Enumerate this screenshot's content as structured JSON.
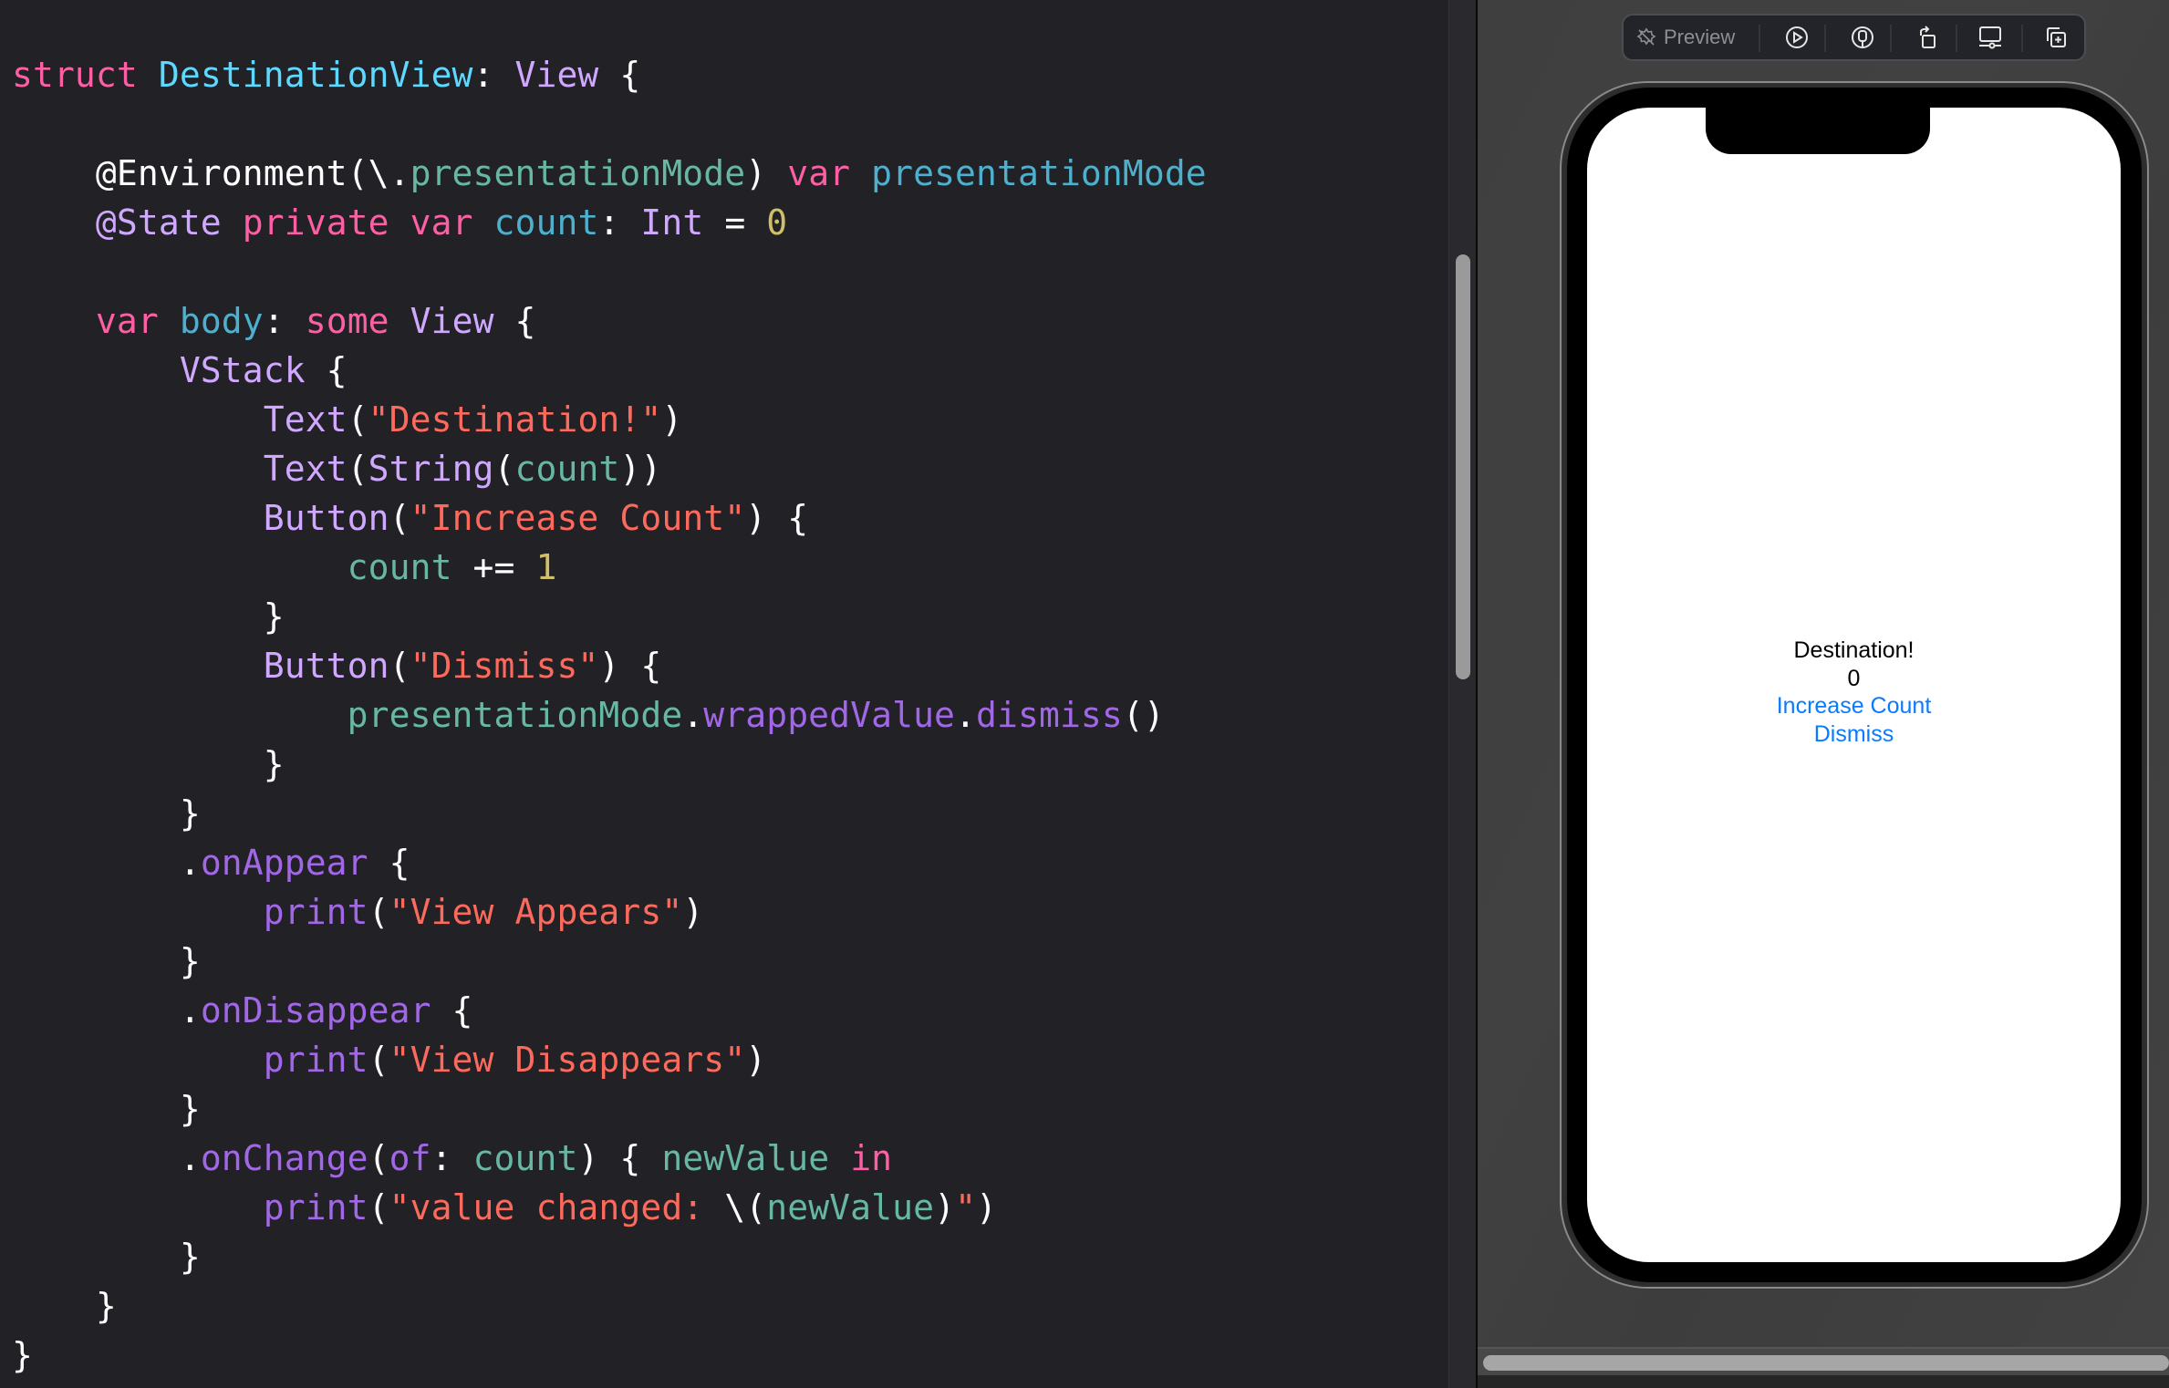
{
  "editor": {
    "language": "swift",
    "lines": [
      [
        [
          "kw",
          "struct"
        ],
        [
          "plain",
          " "
        ],
        [
          "decl",
          "DestinationView"
        ],
        [
          "plain",
          ": "
        ],
        [
          "type",
          "View"
        ],
        [
          "plain",
          " {"
        ]
      ],
      [],
      [
        [
          "plain",
          "    @Environment(\\."
        ],
        [
          "ref",
          "presentationMode"
        ],
        [
          "plain",
          ") "
        ],
        [
          "kw",
          "var"
        ],
        [
          "plain",
          " "
        ],
        [
          "decl2",
          "presentationMode"
        ]
      ],
      [
        [
          "plain",
          "    "
        ],
        [
          "attr",
          "@State"
        ],
        [
          "plain",
          " "
        ],
        [
          "kw",
          "private"
        ],
        [
          "plain",
          " "
        ],
        [
          "kw",
          "var"
        ],
        [
          "plain",
          " "
        ],
        [
          "decl2",
          "count"
        ],
        [
          "plain",
          ": "
        ],
        [
          "type",
          "Int"
        ],
        [
          "plain",
          " = "
        ],
        [
          "num",
          "0"
        ]
      ],
      [],
      [
        [
          "plain",
          "    "
        ],
        [
          "kw",
          "var"
        ],
        [
          "plain",
          " "
        ],
        [
          "decl2",
          "body"
        ],
        [
          "plain",
          ": "
        ],
        [
          "kw",
          "some"
        ],
        [
          "plain",
          " "
        ],
        [
          "type",
          "View"
        ],
        [
          "plain",
          " {"
        ]
      ],
      [
        [
          "plain",
          "        "
        ],
        [
          "type",
          "VStack"
        ],
        [
          "plain",
          " {"
        ]
      ],
      [
        [
          "plain",
          "            "
        ],
        [
          "type",
          "Text"
        ],
        [
          "plain",
          "("
        ],
        [
          "str",
          "\"Destination!\""
        ],
        [
          "plain",
          ")"
        ]
      ],
      [
        [
          "plain",
          "            "
        ],
        [
          "type",
          "Text"
        ],
        [
          "plain",
          "("
        ],
        [
          "type",
          "String"
        ],
        [
          "plain",
          "("
        ],
        [
          "ref",
          "count"
        ],
        [
          "plain",
          "))"
        ]
      ],
      [
        [
          "plain",
          "            "
        ],
        [
          "type",
          "Button"
        ],
        [
          "plain",
          "("
        ],
        [
          "str",
          "\"Increase Count\""
        ],
        [
          "plain",
          ") {"
        ]
      ],
      [
        [
          "plain",
          "                "
        ],
        [
          "ref",
          "count"
        ],
        [
          "plain",
          " += "
        ],
        [
          "num",
          "1"
        ]
      ],
      [
        [
          "plain",
          "            }"
        ]
      ],
      [
        [
          "plain",
          "            "
        ],
        [
          "type",
          "Button"
        ],
        [
          "plain",
          "("
        ],
        [
          "str",
          "\"Dismiss\""
        ],
        [
          "plain",
          ") {"
        ]
      ],
      [
        [
          "plain",
          "                "
        ],
        [
          "ref",
          "presentationMode"
        ],
        [
          "plain",
          "."
        ],
        [
          "fn",
          "wrappedValue"
        ],
        [
          "plain",
          "."
        ],
        [
          "fn",
          "dismiss"
        ],
        [
          "plain",
          "()"
        ]
      ],
      [
        [
          "plain",
          "            }"
        ]
      ],
      [
        [
          "plain",
          "        }"
        ]
      ],
      [
        [
          "plain",
          "        ."
        ],
        [
          "fn",
          "onAppear"
        ],
        [
          "plain",
          " {"
        ]
      ],
      [
        [
          "plain",
          "            "
        ],
        [
          "fn",
          "print"
        ],
        [
          "plain",
          "("
        ],
        [
          "str",
          "\"View Appears\""
        ],
        [
          "plain",
          ")"
        ]
      ],
      [
        [
          "plain",
          "        }"
        ]
      ],
      [
        [
          "plain",
          "        ."
        ],
        [
          "fn",
          "onDisappear"
        ],
        [
          "plain",
          " {"
        ]
      ],
      [
        [
          "plain",
          "            "
        ],
        [
          "fn",
          "print"
        ],
        [
          "plain",
          "("
        ],
        [
          "str",
          "\"View Disappears\""
        ],
        [
          "plain",
          ")"
        ]
      ],
      [
        [
          "plain",
          "        }"
        ]
      ],
      [
        [
          "plain",
          "        ."
        ],
        [
          "fn",
          "onChange"
        ],
        [
          "plain",
          "("
        ],
        [
          "fn",
          "of"
        ],
        [
          "plain",
          ": "
        ],
        [
          "ref",
          "count"
        ],
        [
          "plain",
          ") { "
        ],
        [
          "ref",
          "newValue"
        ],
        [
          "plain",
          " "
        ],
        [
          "kw",
          "in"
        ]
      ],
      [
        [
          "plain",
          "            "
        ],
        [
          "fn",
          "print"
        ],
        [
          "plain",
          "("
        ],
        [
          "str",
          "\"value changed: "
        ],
        [
          "plain",
          "\\("
        ],
        [
          "ref",
          "newValue"
        ],
        [
          "plain",
          ")"
        ],
        [
          "str",
          "\""
        ],
        [
          "plain",
          ")"
        ]
      ],
      [
        [
          "plain",
          "        }"
        ]
      ],
      [
        [
          "plain",
          "    }"
        ]
      ],
      [
        [
          "plain",
          "}"
        ]
      ]
    ],
    "colors": {
      "background": "#212126",
      "keyword": "#fc5fa3",
      "type_declaration": "#5dd8ff",
      "other_declaration": "#4eb0cc",
      "type": "#d0a8ff",
      "reference": "#67b7a4",
      "function": "#a167e6",
      "string": "#fc6a5d",
      "number": "#d0bf69",
      "plain": "#ffffff"
    }
  },
  "preview_toolbar": {
    "label": "Preview",
    "items": [
      {
        "icon": "live-preview-off-icon",
        "label": "Preview"
      },
      {
        "icon": "play-icon"
      },
      {
        "icon": "device-icon"
      },
      {
        "icon": "rotate-icon"
      },
      {
        "icon": "device-settings-icon"
      },
      {
        "icon": "duplicate-icon"
      }
    ]
  },
  "simulator": {
    "device": "iPhone",
    "screen": {
      "title_text": "Destination!",
      "count_text": "0",
      "increase_button_label": "Increase Count",
      "dismiss_button_label": "Dismiss"
    },
    "colors": {
      "text": "#000000",
      "button_tint": "#0a7aff",
      "screen_background": "#ffffff"
    }
  }
}
